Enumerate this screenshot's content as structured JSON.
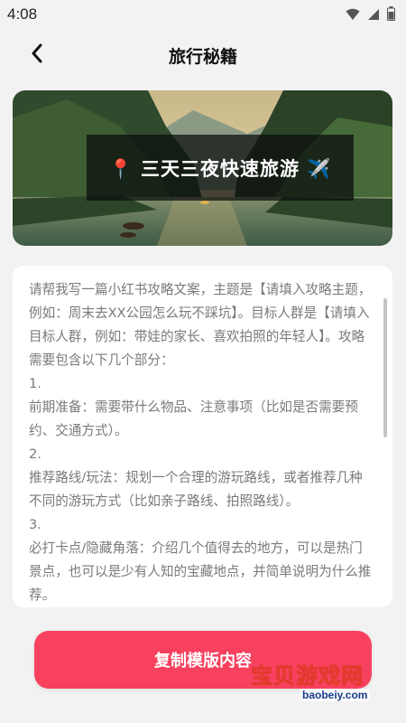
{
  "status_bar": {
    "time": "4:08",
    "icons": [
      "wifi-icon",
      "signal-icon",
      "battery-icon"
    ]
  },
  "header": {
    "title": "旅行秘籍",
    "back_icon": "chevron-left-icon"
  },
  "banner": {
    "caption": "📍 三天三夜快速旅游 ✈️"
  },
  "template": {
    "text": "请帮我写一篇小红书攻略文案，主题是【请填入攻略主题，例如：周末去XX公园怎么玩不踩坑】。目标人群是【请填入目标人群，例如：带娃的家长、喜欢拍照的年轻人】。攻略需要包含以下几个部分：\n1.\n前期准备：需要带什么物品、注意事项（比如是否需要预约、交通方式）。\n2.\n推荐路线/玩法：规划一个合理的游玩路线，或者推荐几种不同的游玩方式（比如亲子路线、拍照路线）。\n3.\n必打卡点/隐藏角落：介绍几个值得去的地方，可以是热门景点，也可以是少有人知的宝藏地点，并简单说明为什么推荐。"
  },
  "actions": {
    "copy_label": "复制模版内容"
  },
  "watermark": {
    "text": "宝贝游戏网",
    "url": "baobeiy.com"
  },
  "colors": {
    "accent": "#f7415f",
    "background": "#f2f2f2",
    "card": "#ffffff",
    "body_text": "#7a7a7a"
  }
}
